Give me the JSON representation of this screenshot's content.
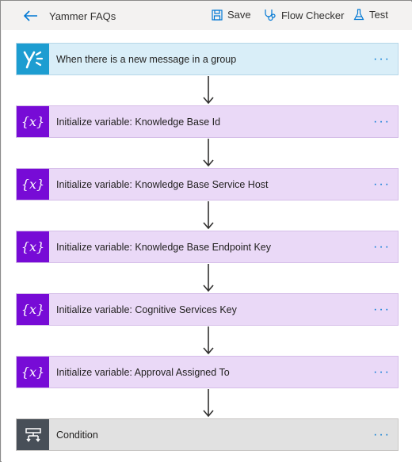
{
  "header": {
    "title": "Yammer FAQs",
    "back_icon": "arrow-left-icon",
    "save_label": "Save",
    "flow_checker_label": "Flow Checker",
    "test_label": "Test"
  },
  "steps": [
    {
      "type": "trigger",
      "label": "When there is a new message in a group",
      "icon": "yammer-icon"
    },
    {
      "type": "variable",
      "label": "Initialize variable: Knowledge Base Id",
      "icon": "variable-icon"
    },
    {
      "type": "variable",
      "label": "Initialize variable: Knowledge Base Service Host",
      "icon": "variable-icon"
    },
    {
      "type": "variable",
      "label": "Initialize variable: Knowledge Base Endpoint Key",
      "icon": "variable-icon"
    },
    {
      "type": "variable",
      "label": "Initialize variable: Cognitive Services Key",
      "icon": "variable-icon"
    },
    {
      "type": "variable",
      "label": "Initialize variable: Approval Assigned To",
      "icon": "variable-icon"
    },
    {
      "type": "control",
      "label": "Condition",
      "icon": "condition-icon"
    }
  ],
  "more_glyph": "···",
  "variable_glyph": "{x}",
  "colors": {
    "accent": "#0078d4",
    "trigger_bg": "#d9eef8",
    "trigger_icon_bg": "#1d9dd1",
    "variable_bg": "#ead9f7",
    "variable_icon_bg": "#770bd6",
    "control_bg": "#e1e1e1",
    "control_icon_bg": "#484f58"
  }
}
